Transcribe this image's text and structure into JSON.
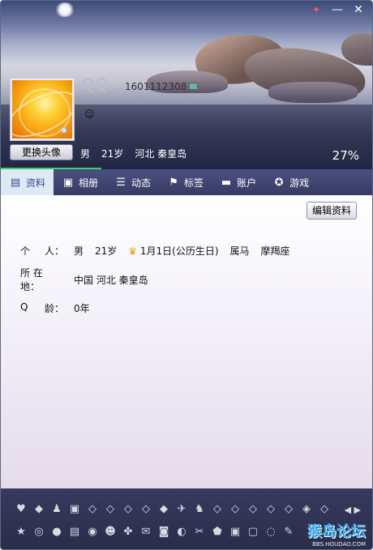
{
  "window": {
    "controls": {
      "skin_icon": "✦",
      "minimize": "—",
      "close": "✕"
    }
  },
  "profile": {
    "nickname": "QQ",
    "qq_number": "1601112308",
    "change_avatar_label": "更换头像",
    "gender": "男",
    "age": "21岁",
    "location": "河北 秦皇岛",
    "completeness": "27%",
    "completeness_value": 0.27
  },
  "tabs": [
    {
      "label": "资料",
      "icon": "id-card-icon",
      "glyph": "▤",
      "active": true
    },
    {
      "label": "相册",
      "icon": "photo-icon",
      "glyph": "▣"
    },
    {
      "label": "动态",
      "icon": "feed-icon",
      "glyph": "☰"
    },
    {
      "label": "标签",
      "icon": "bookmark-icon",
      "glyph": "⚑"
    },
    {
      "label": "账户",
      "icon": "wallet-icon",
      "glyph": "▬"
    },
    {
      "label": "游戏",
      "icon": "game-icon",
      "glyph": "✪"
    }
  ],
  "content": {
    "edit_label": "编辑资料",
    "personal": {
      "label_a": "个",
      "label_b": "人：",
      "gender": "男",
      "age": "21岁",
      "birthday": "1月1日(公历生日)",
      "zodiac": "属马",
      "constellation": "摩羯座"
    },
    "location": {
      "label": "所 在 地：",
      "value": "中国 河北 秦皇岛"
    },
    "qage": {
      "label_a": "Q",
      "label_b": "龄：",
      "value": "0年"
    }
  },
  "plugins": {
    "row1": [
      "♥",
      "◆",
      "♟",
      "▣",
      "◇",
      "◇",
      "◇",
      "◇",
      "◆",
      "✈",
      "♞",
      "◇",
      "◇",
      "◇",
      "◇",
      "◇",
      "◈",
      "◇"
    ],
    "row2": [
      "★",
      "◎",
      "●",
      "▤",
      "◉",
      "☻",
      "✤",
      "✉",
      "◙",
      "◐",
      "✂",
      "⬟",
      "▣",
      "▢",
      "◌",
      "✎"
    ],
    "arrows": "◀ ▶",
    "watermark": "猴岛论坛",
    "watermark_url": "BBS.HOUDAO.COM"
  },
  "colors": {
    "progress": "#3ad26b",
    "active_tab_bg": "#dfe8f5",
    "active_tab_text": "#2f4f8a",
    "tab_bar": "#3f4370"
  }
}
